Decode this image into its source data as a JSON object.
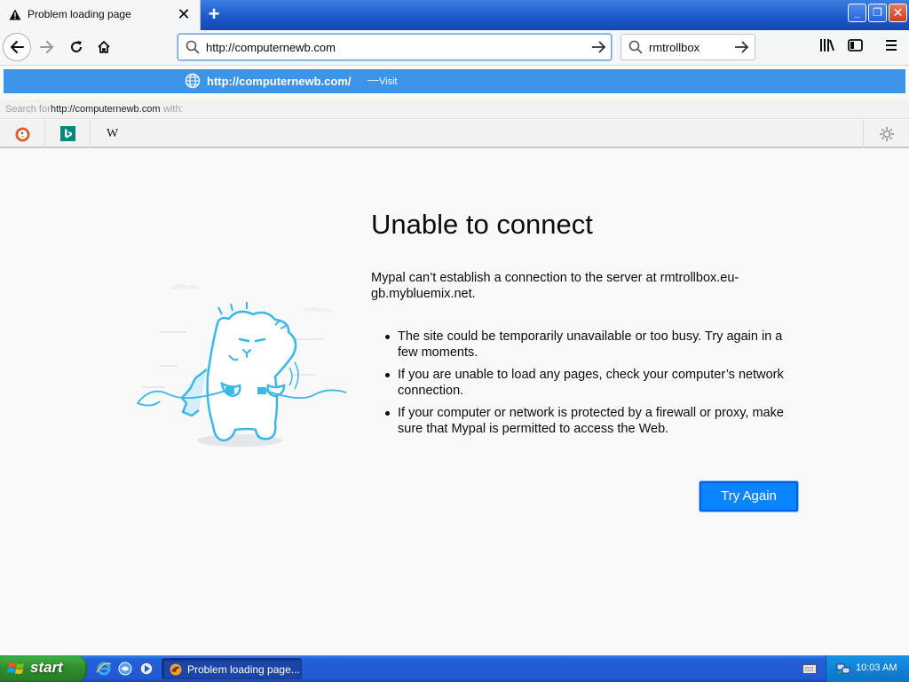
{
  "browser": {
    "tab": {
      "title": "Problem loading page",
      "close_glyph": "✕"
    },
    "new_tab_glyph": "+",
    "window_controls": {
      "minimize": "_",
      "maximize": "❐",
      "close": "✕"
    },
    "url": "http://computernewb.com",
    "search_query": "rmtrollbox",
    "suggestion": {
      "url": "http://computernewb.com/",
      "separator": "—",
      "action": "Visit"
    },
    "search_for": {
      "prefix": "Search for",
      "term": "http://computernewb.com",
      "suffix": "with:"
    },
    "search_engines": [
      "duckduckgo-icon",
      "bing-icon",
      "wikipedia-icon"
    ],
    "wiki_glyph": "W"
  },
  "error_page": {
    "title": "Unable to connect",
    "description": "Mypal can’t establish a connection to the server at rmtrollbox.eu-gb.mybluemix.net.",
    "tips": [
      "The site could be temporarily unavailable or too busy. Try again in a few moments.",
      "If you are unable to load any pages, check your computer’s network connection.",
      "If your computer or network is protected by a firewall or proxy, make sure that Mypal is permitted to access the Web."
    ],
    "button": "Try Again"
  },
  "taskbar": {
    "start_label": "start",
    "task_label": "Problem loading page...",
    "clock": "10:03 AM"
  },
  "colors": {
    "accent": "#0a84ff",
    "suggestion_bar": "#3d94e9",
    "taskbar": "#245edb",
    "start": "#2f8b2f"
  }
}
